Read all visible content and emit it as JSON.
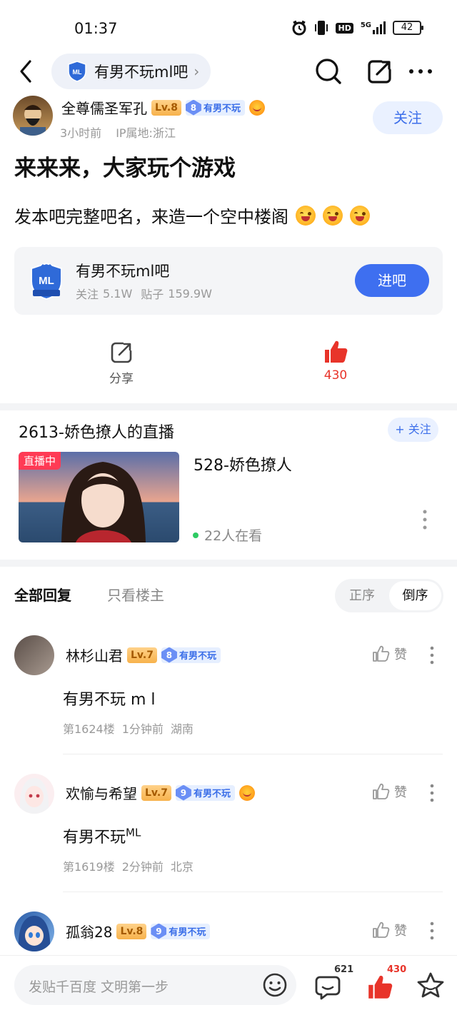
{
  "status_bar": {
    "time": "01:37",
    "network": "5G",
    "battery": "42"
  },
  "nav": {
    "forum_name": "有男不玩ml吧"
  },
  "post": {
    "author": "全尊儒圣军孔",
    "level": "Lv.8",
    "badge_num": "8",
    "badge_text": "有男不玩",
    "time": "3小时前",
    "ip": "IP属地:浙江",
    "follow": "关注",
    "title": "来来来，大家玩个游戏",
    "body": "发本吧完整吧名，来造一个空中楼阁"
  },
  "forum_card": {
    "name": "有男不玩ml吧",
    "follow_label": "关注",
    "follow_count": "5.1W",
    "posts_label": "贴子",
    "posts_count": "159.9W",
    "enter": "进吧"
  },
  "actions": {
    "share": "分享",
    "likes": "430"
  },
  "live": {
    "title": "2613-娇色撩人的直播",
    "follow": "+ 关注",
    "tag": "直播中",
    "name": "528-娇色撩人",
    "viewers": "22人在看"
  },
  "replies_header": {
    "all": "全部回复",
    "op_only": "只看楼主",
    "asc": "正序",
    "desc": "倒序"
  },
  "replies": [
    {
      "name": "林杉山君",
      "level": "Lv.7",
      "badge_num": "8",
      "badge_text": "有男不玩",
      "text": "有男不玩 m l",
      "floor": "第1624楼",
      "time": "1分钟前",
      "location": "湖南",
      "like": "赞"
    },
    {
      "name": "欢愉与希望",
      "level": "Lv.7",
      "badge_num": "9",
      "badge_text": "有男不玩",
      "text": "有男不玩",
      "text_sup": "ML",
      "floor": "第1619楼",
      "time": "2分钟前",
      "location": "北京",
      "like": "赞"
    },
    {
      "name": "孤翁28",
      "level": "Lv.8",
      "badge_num": "9",
      "badge_text": "有男不玩",
      "like": "赞"
    }
  ],
  "bottom_bar": {
    "placeholder": "发贴千百度 文明第一步",
    "comments": "621",
    "likes": "430"
  },
  "colors": {
    "accent": "#3e6ff0",
    "like_red": "#e8342a",
    "level_gold": "#f7b24c"
  }
}
